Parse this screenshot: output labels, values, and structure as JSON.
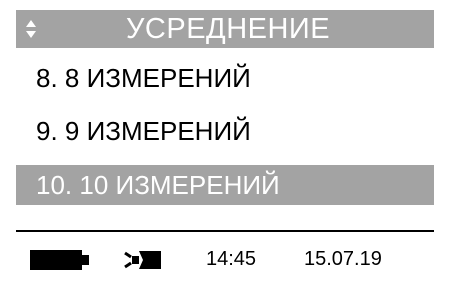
{
  "header": {
    "title": "УСРЕДНЕНИЕ",
    "icon": "up-down-arrows-icon"
  },
  "menu": {
    "items": [
      {
        "label": "8. 8 ИЗМЕРЕНИЙ",
        "selected": false
      },
      {
        "label": "9. 9 ИЗМЕРЕНИЙ",
        "selected": false
      },
      {
        "label": "10. 10 ИЗМЕРЕНИЙ",
        "selected": true
      }
    ]
  },
  "status": {
    "battery_icon": "battery-icon",
    "power_icon": "power-plug-icon",
    "time": "14:45",
    "date": "15.07.19"
  },
  "colors": {
    "highlight": "#a3a3a3",
    "text": "#000000",
    "highlight_text": "#ffffff"
  }
}
